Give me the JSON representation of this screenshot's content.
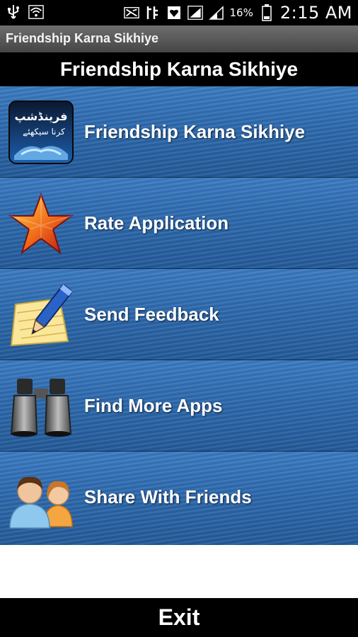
{
  "status_bar": {
    "battery_percent": "16%",
    "time": "2:15 AM",
    "icons": [
      "usb-icon",
      "wifi-icon",
      "mute-icon",
      "data-icon",
      "heart-icon",
      "signal-icon",
      "signal-icon",
      "battery-icon"
    ]
  },
  "app_title": "Friendship Karna Sikhiye",
  "header_title": "Friendship Karna Sikhiye",
  "menu": {
    "items": [
      {
        "label": "Friendship Karna Sikhiye",
        "icon": "friendship-logo-icon",
        "urdu_text": "فرینڈشپ\nکرنا سیکھئے"
      },
      {
        "label": "Rate Application",
        "icon": "star-icon"
      },
      {
        "label": "Send Feedback",
        "icon": "pencil-notepad-icon"
      },
      {
        "label": "Find More Apps",
        "icon": "binoculars-icon"
      },
      {
        "label": "Share With Friends",
        "icon": "people-icon"
      }
    ]
  },
  "exit_label": "Exit",
  "colors": {
    "row_blue": "#2d69ad",
    "black": "#000000",
    "white": "#ffffff"
  }
}
